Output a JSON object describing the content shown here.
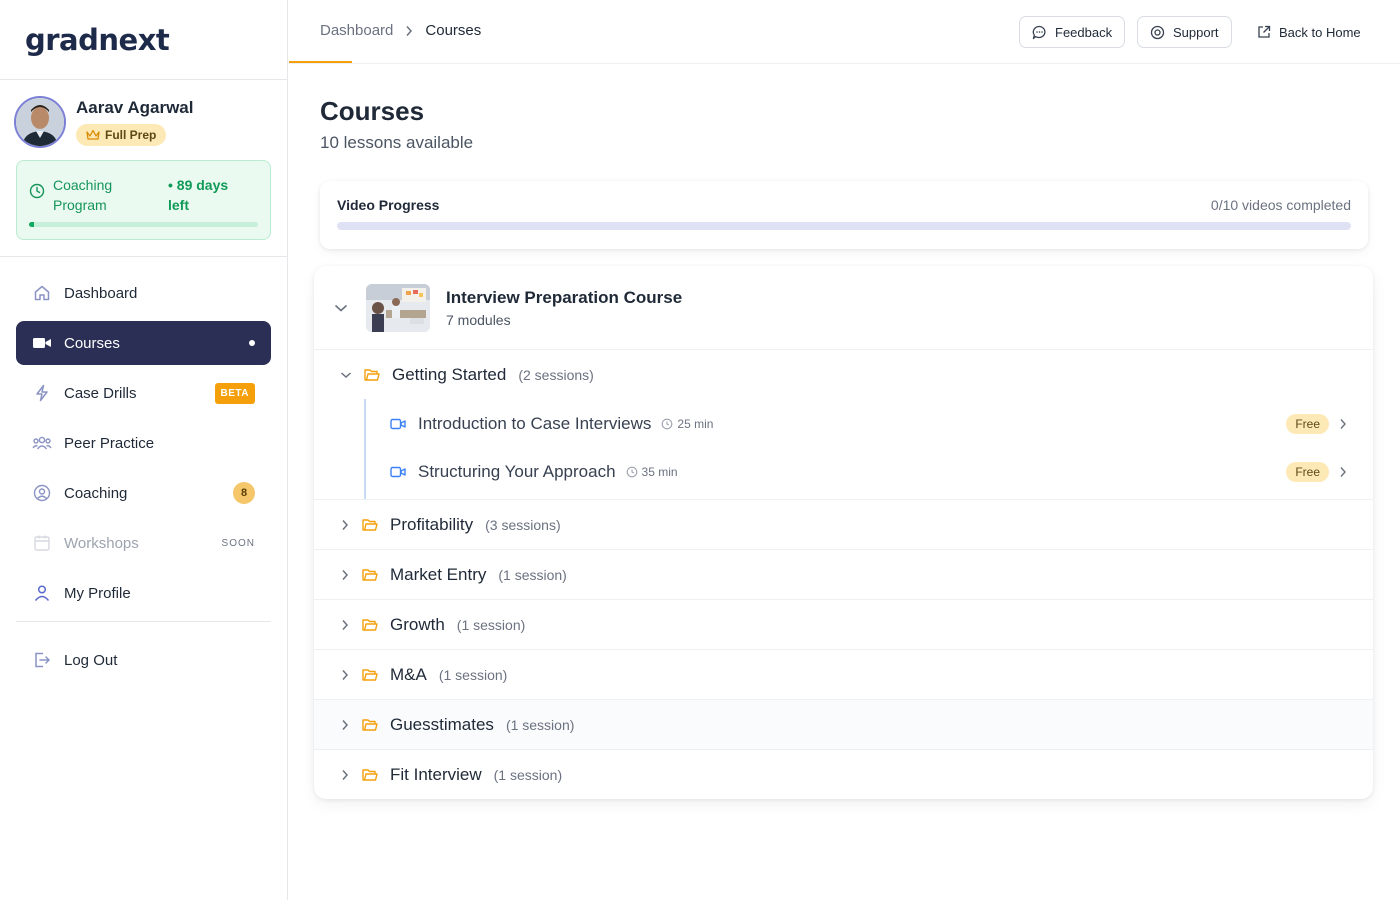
{
  "brand": {
    "name": "gradnext"
  },
  "profile": {
    "name": "Aarav Agarwal",
    "plan": "Full Prep"
  },
  "coaching": {
    "title": "Coaching Program",
    "days_left": "• 89 days left",
    "progress_fraction": 0.02
  },
  "nav": {
    "items": [
      {
        "label": "Dashboard",
        "icon": "home-icon"
      },
      {
        "label": "Courses",
        "icon": "video-icon",
        "active": true
      },
      {
        "label": "Case Drills",
        "icon": "lightning-icon",
        "badge": "BETA"
      },
      {
        "label": "Peer Practice",
        "icon": "users-icon"
      },
      {
        "label": "Coaching",
        "icon": "user-circle-icon",
        "count": "8"
      },
      {
        "label": "Workshops",
        "icon": "calendar-icon",
        "tag": "SOON"
      },
      {
        "label": "My Profile",
        "icon": "user-icon"
      }
    ],
    "logout": "Log Out"
  },
  "header": {
    "breadcrumb": [
      "Dashboard",
      "Courses"
    ],
    "feedback": "Feedback",
    "support": "Support",
    "back_home": "Back to Home"
  },
  "page": {
    "title": "Courses",
    "subtitle": "10 lessons available"
  },
  "progress": {
    "label": "Video Progress",
    "stat": "0/10 videos completed",
    "completed": 0,
    "total": 10
  },
  "course": {
    "name": "Interview Preparation Course",
    "modules_count": "7 modules",
    "modules": [
      {
        "name": "Getting Started",
        "count": "(2 sessions)",
        "sessions": [
          {
            "name": "Introduction to Case Interviews",
            "duration": "25 min",
            "tag": "Free"
          },
          {
            "name": "Structuring Your Approach",
            "duration": "35 min",
            "tag": "Free"
          }
        ]
      },
      {
        "name": "Profitability",
        "count": "(3 sessions)"
      },
      {
        "name": "Market Entry",
        "count": "(1 session)"
      },
      {
        "name": "Growth",
        "count": "(1 session)"
      },
      {
        "name": "M&A",
        "count": "(1 session)"
      },
      {
        "name": "Guesstimates",
        "count": "(1 session)"
      },
      {
        "name": "Fit Interview",
        "count": "(1 session)"
      }
    ]
  },
  "colors": {
    "accent": "#f5a00b",
    "nav_active": "#2b2f55",
    "success": "#13a862",
    "folder": "#f5a00b",
    "video": "#3b82f6"
  }
}
